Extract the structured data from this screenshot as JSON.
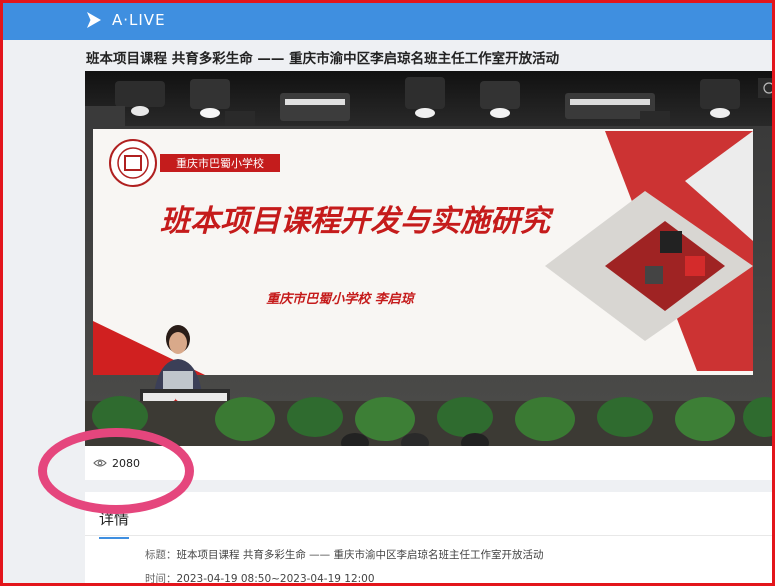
{
  "app": {
    "logo_text": "A·LIVE",
    "brand_color": "#3f8fe0"
  },
  "page": {
    "title": "班本项目课程 共育多彩生命 —— 重庆市渝中区李启琼名班主任工作室开放活动"
  },
  "video": {
    "slide_school_badge": "重庆市巴蜀小学校",
    "slide_title": "班本项目课程开发与实施研究",
    "slide_presenter": "重庆市巴蜀小学校  李启琼"
  },
  "stats": {
    "view_icon": "eye-icon",
    "views": "2080"
  },
  "details": {
    "tab_label": "详情",
    "title_label": "标题：",
    "title_value": "班本项目课程 共育多彩生命 —— 重庆市渝中区李启琼名班主任工作室开放活动",
    "time_label": "时间：",
    "time_value": "2023-04-19 08:50~2023-04-19 12:00"
  },
  "annotation": {
    "frame_color": "#e3151b",
    "ring_color": "#e5467d"
  }
}
